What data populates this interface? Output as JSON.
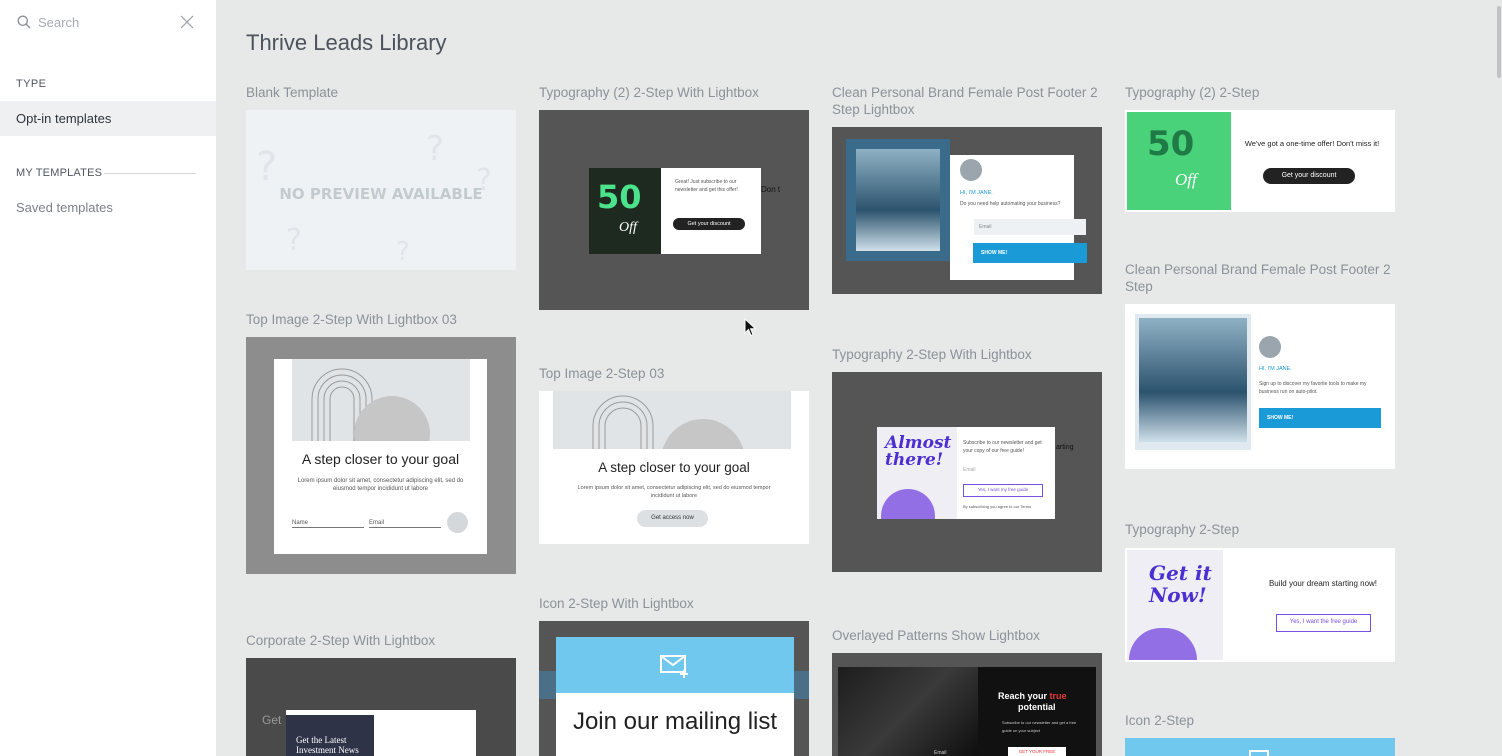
{
  "sidebar": {
    "search": {
      "placeholder": "Search",
      "value": ""
    },
    "type_heading": "TYPE",
    "type_item": "Opt-in templates",
    "my_templates_heading": "MY TEMPLATES",
    "saved_item": "Saved templates"
  },
  "main": {
    "title": "Thrive Leads Library",
    "templates": [
      {
        "title": "Blank Template",
        "preview_text": "NO PREVIEW AVAILABLE"
      },
      {
        "title": "Typography (2) 2-Step With Lightbox",
        "preview_text": "Great! Just subscribe to our newsletter and get this offer!",
        "button": "Get your discount",
        "badge_big": "50",
        "badge_off": "Off",
        "side_text": "Don t"
      },
      {
        "title": "Clean Personal Brand Female Post Footer 2 Step Lightbox",
        "greeting": "HI, I'M JANE.",
        "question": "Do you need help automating your business?",
        "email_ph": "Email",
        "button": "SHOW ME!"
      },
      {
        "title": "Typography (2) 2-Step",
        "badge_big": "50",
        "badge_off": "Off",
        "offer": "We've got a one-time offer! Don't miss it!",
        "button": "Get your discount"
      },
      {
        "title": "Top Image 2-Step With Lightbox 03",
        "headline": "A step closer to your goal",
        "body": "Lorem ipsum dolor sit amet, consectetur adipiscing elit, sed do eiusmod tempor incididunt ut labore",
        "name_ph": "Name",
        "email_ph": "Email"
      },
      {
        "title": "Top Image 2-Step 03",
        "headline": "A step closer to your goal",
        "body": "Lorem ipsum dolor sit amet, consectetur adipiscing elit, sed do eiusmod tempor incididunt ut labore",
        "button": "Get access now"
      },
      {
        "title": "Typography 2-Step With Lightbox",
        "script_text": "Almost there!",
        "text": "Subscribe to our newsletter and get your copy of our free guide!",
        "email_ph": "Email",
        "button": "Yes, I want my free guide",
        "fine": "By subscribing you agree to our Terms",
        "side_text": "arting"
      },
      {
        "title": "Clean Personal Brand Female Post Footer 2 Step",
        "greeting": "HI, I'M JANE.",
        "text": "Sign up to discover my favorite tools to make my business run on auto-pilot.",
        "button": "SHOW ME!"
      },
      {
        "title": "Typography 2-Step",
        "script_text": "Get it Now!",
        "text": "Build your dream starting now!",
        "button": "Yes, I want the free guide"
      },
      {
        "title": "Icon 2-Step With Lightbox",
        "headline": "Join our mailing list"
      },
      {
        "title": "Overlayed Patterns Show Lightbox",
        "headline_a": "Reach your",
        "headline_b": "true",
        "headline_c": "potential",
        "sub": "Subscribe to our newsletter and get a free guide on your subject",
        "email_label": "Email",
        "button": "GET YOUR FREE"
      },
      {
        "title": "Corporate 2-Step With Lightbox",
        "headline": "Get the Latest Investment News",
        "side_text": "Get"
      },
      {
        "title": "Icon 2-Step"
      }
    ]
  },
  "colors": {
    "accent_blue": "#1a9bd7",
    "purple": "#7b4fe0",
    "green": "#49d27a",
    "light_blue": "#71c8ef",
    "red_accent": "#e53935"
  }
}
